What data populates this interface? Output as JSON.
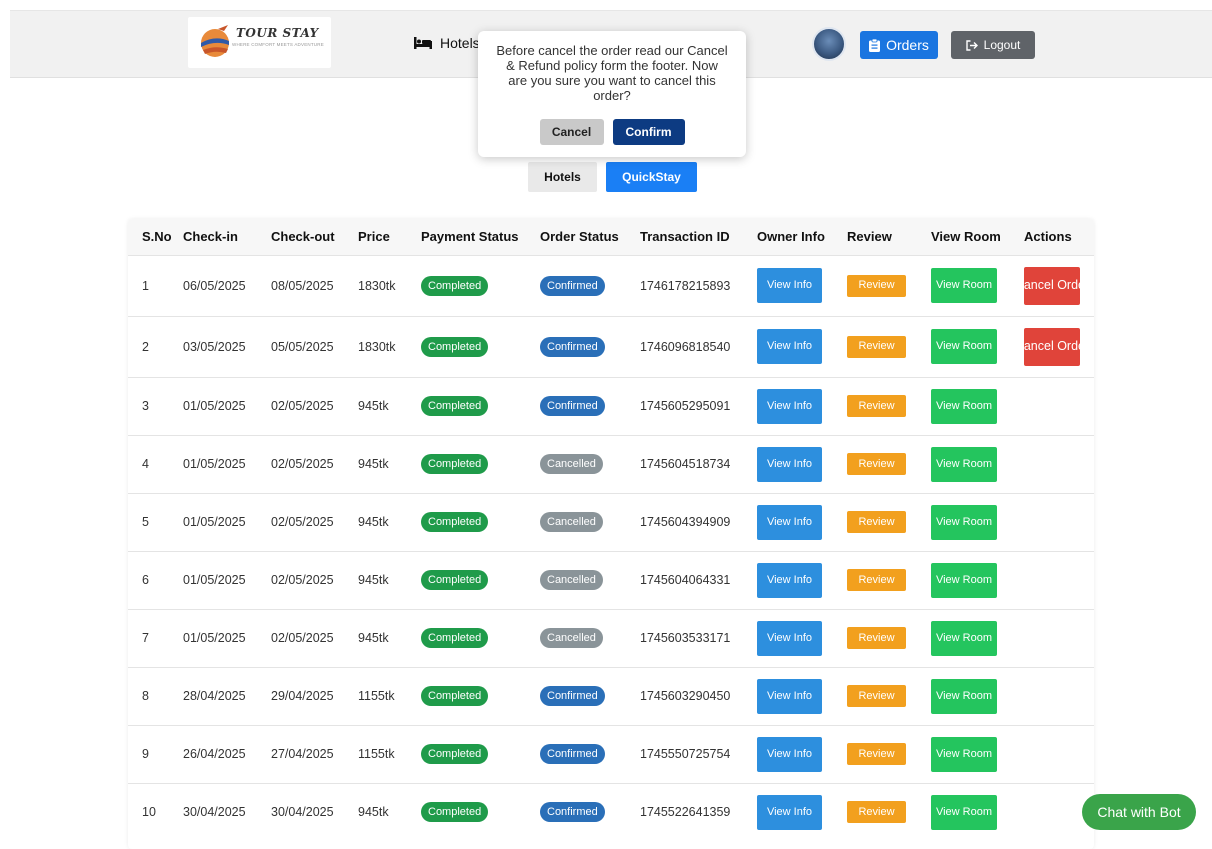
{
  "brand": {
    "name": "TOUR STAY",
    "tagline": "WHERE COMFORT MEETS ADVENTURE"
  },
  "nav": {
    "hotels_label": "Hotels",
    "hotels_icon": "bed-icon"
  },
  "header": {
    "orders_label": "Orders",
    "orders_icon": "clipboard-icon",
    "logout_label": "Logout",
    "logout_icon": "logout-icon"
  },
  "modal": {
    "message": "Before cancel the order read our Cancel & Refund policy form the footer. Now are you sure you want to cancel this order?",
    "cancel_label": "Cancel",
    "confirm_label": "Confirm"
  },
  "tabs": {
    "hotels_label": "Hotels",
    "quickstay_label": "QuickStay",
    "active": "QuickStay"
  },
  "table": {
    "columns": [
      "S.No",
      "Check-in",
      "Check-out",
      "Price",
      "Payment Status",
      "Order Status",
      "Transaction ID",
      "Owner Info",
      "Review",
      "View Room",
      "Actions"
    ],
    "rows": [
      {
        "sno": "1",
        "checkin": "06/05/2025",
        "checkout": "08/05/2025",
        "price": "1830tk",
        "payment": "Completed",
        "order": "Confirmed",
        "txn": "1746178215893",
        "owner": "View Info",
        "review": "Review",
        "room": "View Room",
        "action": "Cancel Order"
      },
      {
        "sno": "2",
        "checkin": "03/05/2025",
        "checkout": "05/05/2025",
        "price": "1830tk",
        "payment": "Completed",
        "order": "Confirmed",
        "txn": "1746096818540",
        "owner": "View Info",
        "review": "Review",
        "room": "View Room",
        "action": "Cancel Order"
      },
      {
        "sno": "3",
        "checkin": "01/05/2025",
        "checkout": "02/05/2025",
        "price": "945tk",
        "payment": "Completed",
        "order": "Confirmed",
        "txn": "1745605295091",
        "owner": "View Info",
        "review": "Review",
        "room": "View Room",
        "action": ""
      },
      {
        "sno": "4",
        "checkin": "01/05/2025",
        "checkout": "02/05/2025",
        "price": "945tk",
        "payment": "Completed",
        "order": "Cancelled",
        "txn": "1745604518734",
        "owner": "View Info",
        "review": "Review",
        "room": "View Room",
        "action": ""
      },
      {
        "sno": "5",
        "checkin": "01/05/2025",
        "checkout": "02/05/2025",
        "price": "945tk",
        "payment": "Completed",
        "order": "Cancelled",
        "txn": "1745604394909",
        "owner": "View Info",
        "review": "Review",
        "room": "View Room",
        "action": ""
      },
      {
        "sno": "6",
        "checkin": "01/05/2025",
        "checkout": "02/05/2025",
        "price": "945tk",
        "payment": "Completed",
        "order": "Cancelled",
        "txn": "1745604064331",
        "owner": "View Info",
        "review": "Review",
        "room": "View Room",
        "action": ""
      },
      {
        "sno": "7",
        "checkin": "01/05/2025",
        "checkout": "02/05/2025",
        "price": "945tk",
        "payment": "Completed",
        "order": "Cancelled",
        "txn": "1745603533171",
        "owner": "View Info",
        "review": "Review",
        "room": "View Room",
        "action": ""
      },
      {
        "sno": "8",
        "checkin": "28/04/2025",
        "checkout": "29/04/2025",
        "price": "1155tk",
        "payment": "Completed",
        "order": "Confirmed",
        "txn": "1745603290450",
        "owner": "View Info",
        "review": "Review",
        "room": "View Room",
        "action": ""
      },
      {
        "sno": "9",
        "checkin": "26/04/2025",
        "checkout": "27/04/2025",
        "price": "1155tk",
        "payment": "Completed",
        "order": "Confirmed",
        "txn": "1745550725754",
        "owner": "View Info",
        "review": "Review",
        "room": "View Room",
        "action": ""
      },
      {
        "sno": "10",
        "checkin": "30/04/2025",
        "checkout": "30/04/2025",
        "price": "945tk",
        "payment": "Completed",
        "order": "Confirmed",
        "txn": "1745522641359",
        "owner": "View Info",
        "review": "Review",
        "room": "View Room",
        "action": ""
      }
    ]
  },
  "chat": {
    "label": "Chat with Bot"
  },
  "colors": {
    "primary": "#1a75e0",
    "success": "#1f9b4a",
    "confirmed": "#2a6fb8",
    "cancelled": "#8a9499",
    "warning": "#f2a01e",
    "danger": "#e0443a",
    "room": "#24c55e",
    "modal_confirm": "#0d3b82"
  }
}
